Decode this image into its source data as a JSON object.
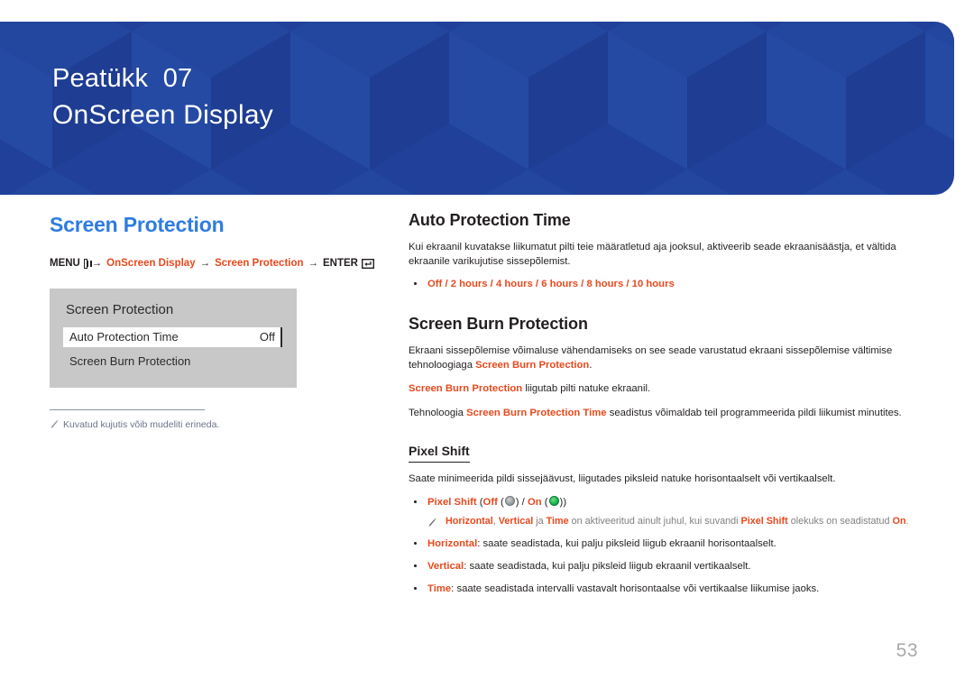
{
  "banner": {
    "chapter_label": "Peatükk",
    "chapter_number": "07",
    "chapter_title": "OnScreen Display",
    "background_color": "#20409a"
  },
  "left_column": {
    "section_title": "Screen Protection",
    "section_title_color": "#2e7ce0",
    "breadcrumb": {
      "menu_label": "MENU",
      "menu_icon": "menu-icon",
      "arrow": "→",
      "path": [
        "OnScreen Display",
        "Screen Protection"
      ],
      "enter_label": "ENTER",
      "enter_icon": "enter-icon",
      "accent_color": "#e8491d"
    },
    "osd": {
      "title": "Screen Protection",
      "rows": [
        {
          "label": "Auto Protection Time",
          "value": "Off",
          "selected": true
        },
        {
          "label": "Screen Burn Protection",
          "value": "",
          "selected": false
        }
      ]
    },
    "note": {
      "icon": "pencil-icon",
      "text": "Kuvatud kujutis võib mudeliti erineda."
    }
  },
  "right_column": {
    "auto_protection_time": {
      "heading": "Auto Protection Time",
      "paragraph": "Kui ekraanil kuvatakse liikumatut pilti teie määratletud aja jooksul, aktiveerib seade ekraanisäästja, et vältida ekraanile varikujutise sissepõlemist.",
      "options": [
        "Off",
        "2 hours",
        "4 hours",
        "6 hours",
        "8 hours",
        "10 hours"
      ],
      "options_separator": " / "
    },
    "screen_burn_protection": {
      "heading": "Screen Burn Protection",
      "p1_a": "Ekraani sissepõlemise võimaluse vähendamiseks on see seade varustatud ekraani sissepõlemise vältimise tehnoloogiaga ",
      "p1_term": "Screen Burn Protection",
      "p1_b": ".",
      "p2_term": "Screen Burn Protection",
      "p2_text": " liigutab pilti natuke ekraanil.",
      "p3_a": "Tehnoloogia ",
      "p3_term": "Screen Burn Protection Time",
      "p3_b": " seadistus võimaldab teil programmeerida pildi liikumist minutites."
    },
    "pixel_shift": {
      "heading": "Pixel Shift",
      "intro": "Saate minimeerida pildi sissejäävust, liigutades piksleid natuke horisontaalselt või vertikaalselt.",
      "toggle_bullet": {
        "term": "Pixel Shift",
        "open": " (",
        "off_label": "Off",
        "off_icon": "toggle-off-icon",
        "middle": ") / ",
        "on_label": "On",
        "on_icon": "toggle-on-icon",
        "close": ")",
        "off_color": "#8f9596",
        "on_color": "#19b24a"
      },
      "subnote": {
        "icon": "pencil-icon",
        "t1": "Horizontal",
        "sep1": ", ",
        "t2": "Vertical",
        "sep2": " ja ",
        "t3": "Time",
        "mid": " on aktiveeritud ainult juhul, kui suvandi ",
        "t4": "Pixel Shift",
        "mid2": " olekuks on seadistatud ",
        "t5": "On",
        "end": "."
      },
      "items": [
        {
          "term": "Horizontal",
          "text": ": saate seadistada, kui palju piksleid liigub ekraanil horisontaalselt."
        },
        {
          "term": "Vertical",
          "text": ": saate seadistada, kui palju piksleid liigub ekraanil vertikaalselt."
        },
        {
          "term": "Time",
          "text": ": saate seadistada intervalli vastavalt horisontaalse või vertikaalse liikumise jaoks."
        }
      ]
    }
  },
  "footer": {
    "page_number": "53"
  }
}
